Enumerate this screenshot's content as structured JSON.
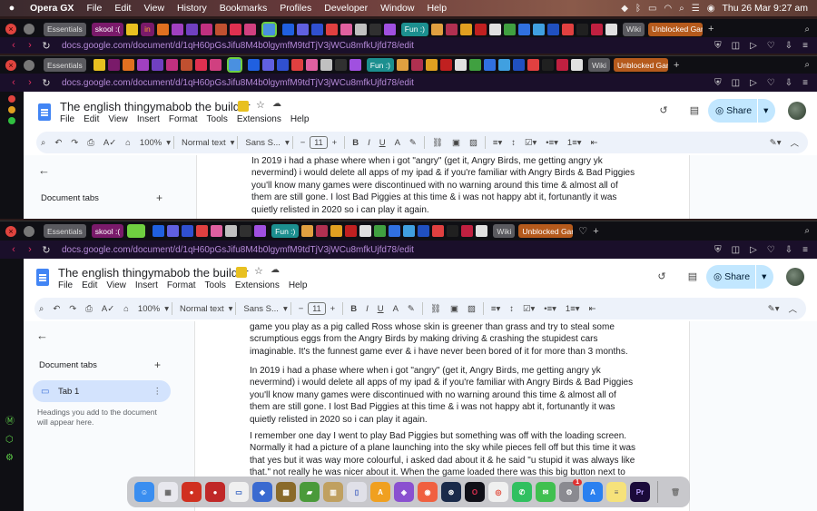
{
  "menubar": {
    "items": [
      "Opera GX",
      "File",
      "Edit",
      "View",
      "History",
      "Bookmarks",
      "Profiles",
      "Developer",
      "Window",
      "Help"
    ],
    "clock": "Thu 26 Mar  9:27 am"
  },
  "browser": {
    "essentials_label": "Essentials",
    "skool_label": "skool :(",
    "in_label": "in",
    "fun_label": "Fun :)",
    "wiki_label": "Wiki",
    "unblocked_label": "Unblocked Gam",
    "url": "docs.google.com/document/d/1qH60pGsJifu8M4b0lgymfM9tdTjV3jWCu8mfkUjfd78/edit",
    "colors": {
      "accent": "#6fd040",
      "frame": "#0f0f14",
      "url": "#b58ad8"
    }
  },
  "docs": {
    "title": "The english thingymabob the builder",
    "menu": [
      "File",
      "Edit",
      "View",
      "Insert",
      "Format",
      "Tools",
      "Extensions",
      "Help"
    ],
    "share_label": "Share",
    "toolbar": {
      "zoom": "100%",
      "style": "Normal text",
      "font": "Sans S...",
      "font_size": "11"
    },
    "sidebar": {
      "heading": "Document tabs",
      "tab1": "Tab 1",
      "hint": "Headings you add to the document will appear here."
    }
  },
  "back_doc": {
    "para_2019": "In 2019 i had a phase where when i got \"angry\" (get it, Angry Birds, me getting angry yk\nnevermind) i would delete all apps of my ipad & if you're familiar with Angry Birds & Bad Piggies\nyou'll know many games were discontinued with no warning around this time & almost all of\nthem are still gone. I lost Bad Piggies at this time & i was not happy abt it, fortunantly it was\nquietly relisted in 2020 so i can play it again."
  },
  "front_doc": {
    "para_intro": "game you play as a pig called Ross whose skin is greener than grass and try to steal some\nscrumptious eggs from the Angry Birds by making driving & crashing the stupidest cars\nimaginable. It's the funnest game ever & i have never been bored of it for more than 3 months.",
    "para_2019": "In 2019 i had a phase where when i got \"angry\" (get it, Angry Birds, me getting angry yk\nnevermind) i would delete all apps of my ipad & if you're familiar with Angry Birds & Bad Piggies\nyou'll know many games were discontinued with no warning around this time & almost all of\nthem are still gone. I lost Bad Piggies at this time & i was not happy abt it, fortunantly it was\nquietly relisted in 2020 so i can play it again.",
    "para_remember": "I remember one day I went to play Bad Piggies but something was off with the loading screen.\nNormally it had a picture of a plane launching into the sky while pieces fell off but this time it was\nthat yes but it was way more colourful, i asked dad about it & he said \"u stupid it was always like\nthat.\" not really he was nicer about it. When the game loaded there was this big button next to"
  },
  "dock": {
    "apps": [
      "finder-icon",
      "launchpad-icon",
      "angry-birds-icon",
      "bad-piggies-icon",
      "preview-icon",
      "game-icon",
      "minecraft-icon",
      "app-icon",
      "notes-icon",
      "pages-icon",
      "docs-icon",
      "brave-icon",
      "steam-icon",
      "opera-gx-icon",
      "chrome-icon",
      "whatsapp-icon",
      "messages-icon",
      "settings-icon",
      "app-store-icon",
      "notes-yellow-icon",
      "premiere-icon",
      "trash-icon"
    ],
    "settings_badge": "1"
  }
}
